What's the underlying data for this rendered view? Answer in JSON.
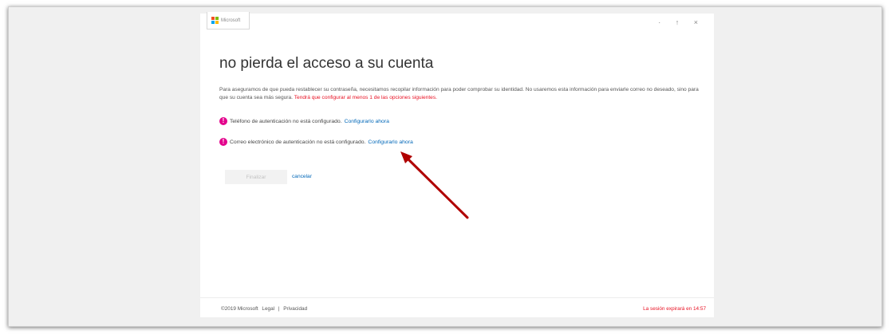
{
  "header": {
    "logo_text": "Microsoft",
    "logo_colors": [
      "#f25022",
      "#7fba00",
      "#00a4ef",
      "#ffb900"
    ],
    "window_controls": "· ↑ ×"
  },
  "main": {
    "title": "no pierda el acceso a su cuenta",
    "description": "Para aseguramos de que pueda restablecer su contraseña, necesitamos recopilar información para poder comprobar su identidad. No usaremos esta información para enviarle correo no deseado, sino para que su cuenta sea más segura.",
    "warning": "Tendrá que configurar al menos 1 de las opciones siguientes.",
    "items": [
      {
        "icon": "exclamation-icon",
        "text": "Teléfono de autenticación no está configurado.",
        "link": "Configurarlo ahora"
      },
      {
        "icon": "exclamation-icon",
        "text": "Correo electrónico de autenticación no está configurado.",
        "link": "Configurarlo ahora"
      }
    ],
    "finish_label": "Finalizar",
    "cancel_label": "cancelar"
  },
  "footer": {
    "copyright": "©2019 Microsoft",
    "legal": "Legal",
    "separator": "|",
    "privacy": "Privacidad",
    "session": "La sesión expirará en 14:57"
  },
  "annotation": {
    "arrow_color": "#b00000"
  }
}
